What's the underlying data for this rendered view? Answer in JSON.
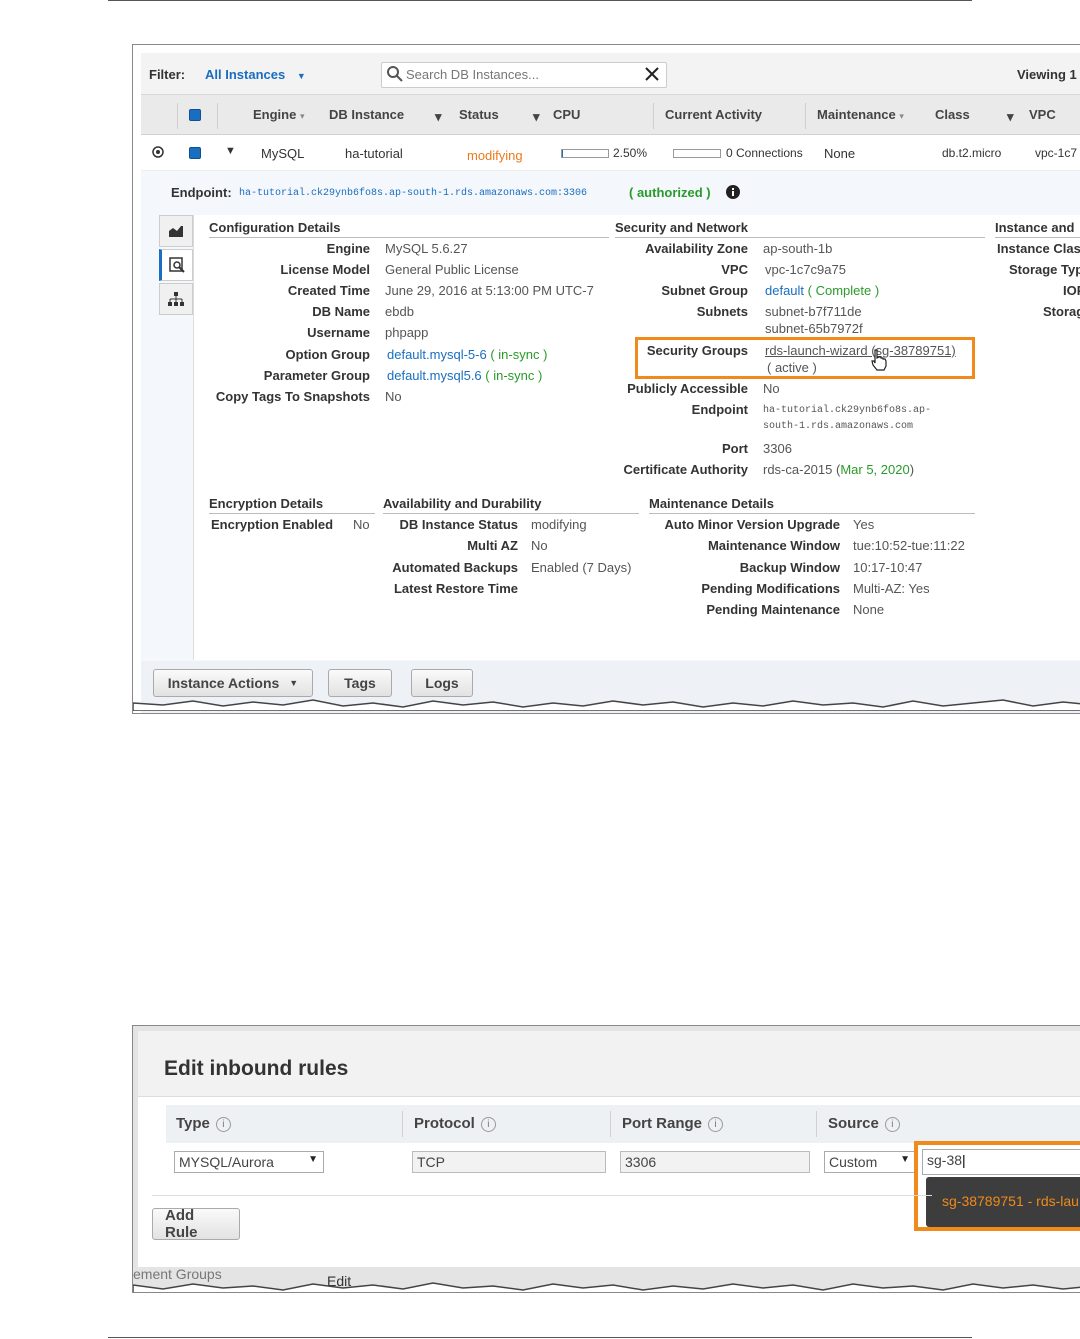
{
  "panel1": {
    "filter_label": "Filter:",
    "filter_value": "All Instances",
    "search_placeholder": "Search DB Instances...",
    "viewing": "Viewing 1",
    "columns": [
      "Engine",
      "DB Instance",
      "Status",
      "CPU",
      "Current Activity",
      "Maintenance",
      "Class",
      "VPC"
    ],
    "row": {
      "engine": "MySQL",
      "instance": "ha-tutorial",
      "status": "modifying",
      "cpu": "2.50%",
      "cpu_fraction": 0.025,
      "activity": "0 Connections",
      "maintenance": "None",
      "class": "db.t2.micro",
      "vpc": "vpc-1c7"
    },
    "endpoint": {
      "label": "Endpoint:",
      "value": "ha-tutorial.ck29ynb6fo8s.ap-south-1.rds.amazonaws.com:3306",
      "status": "( authorized )"
    },
    "config": {
      "title": "Configuration Details",
      "engine_k": "Engine",
      "engine_v": "MySQL 5.6.27",
      "license_k": "License Model",
      "license_v": "General Public License",
      "created_k": "Created Time",
      "created_v": "June 29, 2016 at 5:13:00 PM UTC-7",
      "dbname_k": "DB Name",
      "dbname_v": "ebdb",
      "user_k": "Username",
      "user_v": "phpapp",
      "option_k": "Option Group",
      "option_v": "default.mysql-5-6",
      "option_s": "( in-sync )",
      "param_k": "Parameter Group",
      "param_v": "default.mysql5.6",
      "param_s": "( in-sync )",
      "copy_k": "Copy Tags To Snapshots",
      "copy_v": "No"
    },
    "security": {
      "title": "Security and Network",
      "az_k": "Availability Zone",
      "az_v": "ap-south-1b",
      "vpc_k": "VPC",
      "vpc_v": "vpc-1c7c9a75",
      "subnetgroup_k": "Subnet Group",
      "subnetgroup_v": "default",
      "subnetgroup_s": "( Complete )",
      "subnets_k": "Subnets",
      "subnet1": "subnet-b7f711de",
      "subnet2": "subnet-65b7972f",
      "sg_k": "Security Groups",
      "sg_v": "rds-launch-wizard (sg-38789751)",
      "sg_s": "( active )",
      "public_k": "Publicly Accessible",
      "public_v": "No",
      "endpoint_k": "Endpoint",
      "endpoint_v1": "ha-tutorial.ck29ynb6fo8s.ap-",
      "endpoint_v2": "south-1.rds.amazonaws.com",
      "port_k": "Port",
      "port_v": "3306",
      "cert_k": "Certificate Authority",
      "cert_v": "rds-ca-2015 (",
      "cert_date": "Mar 5, 2020",
      "cert_end": ")"
    },
    "instance_storage": {
      "title": "Instance and",
      "class_k": "Instance Clas",
      "storage_k": "Storage Typ",
      "iops_k": "IOP",
      "storage2_k": "Storag"
    },
    "encryption": {
      "title": "Encryption Details",
      "enabled_k": "Encryption Enabled",
      "enabled_v": "No"
    },
    "availability": {
      "title": "Availability and Durability",
      "status_k": "DB Instance Status",
      "status_v": "modifying",
      "multiaz_k": "Multi AZ",
      "multiaz_v": "No",
      "backups_k": "Automated Backups",
      "backups_v": "Enabled (7 Days)",
      "restore_k": "Latest Restore Time"
    },
    "maintenance": {
      "title": "Maintenance Details",
      "minor_k": "Auto Minor Version Upgrade",
      "minor_v": "Yes",
      "window_k": "Maintenance Window",
      "window_v": "tue:10:52-tue:11:22",
      "backup_k": "Backup Window",
      "backup_v": "10:17-10:47",
      "pending_k": "Pending Modifications",
      "pending_v": "Multi-AZ: Yes",
      "pmaint_k": "Pending Maintenance",
      "pmaint_v": "None"
    },
    "buttons": {
      "actions": "Instance Actions",
      "tags": "Tags",
      "logs": "Logs"
    }
  },
  "panel2": {
    "title": "Edit inbound rules",
    "headers": {
      "type": "Type",
      "protocol": "Protocol",
      "port": "Port Range",
      "source": "Source"
    },
    "row": {
      "type": "MYSQL/Aurora",
      "protocol": "TCP",
      "port": "3306",
      "source_mode": "Custom",
      "source_value": "sg-38"
    },
    "suggestion": "sg-38789751 - rds-lau",
    "add_rule": "Add Rule",
    "behind_text": "ement Groups",
    "behind_edit": "Edit"
  },
  "colors": {
    "highlight": "#f08a1a",
    "link": "#1a6ec0",
    "ok": "#2a9a2a",
    "warn": "#ea7b1c",
    "bad": "#d32020"
  }
}
